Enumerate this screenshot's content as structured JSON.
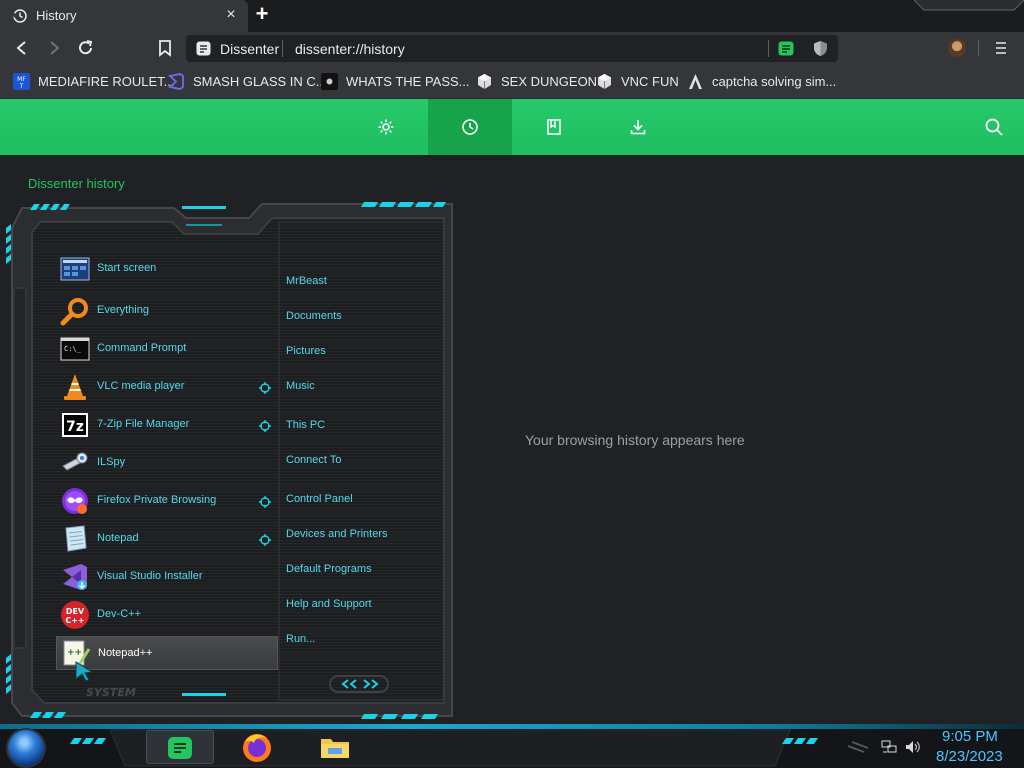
{
  "tab": {
    "title": "History",
    "close_glyph": "×",
    "new_tab_glyph": "+"
  },
  "omnibox": {
    "site": "Dissenter",
    "url": "dissenter://history"
  },
  "bookmarks": [
    {
      "label": "MEDIAFIRE ROULET...",
      "icon": "mediafire-icon"
    },
    {
      "label": "SMASH GLASS IN C...",
      "icon": "visual-studio-icon"
    },
    {
      "label": "WHATS THE PASS...",
      "icon": "gear-favicon-icon"
    },
    {
      "label": "SEX DUNGEON",
      "icon": "cube-favicon-icon"
    },
    {
      "label": "VNC FUN",
      "icon": "cube-favicon-icon"
    },
    {
      "label": "captcha solving sim...",
      "icon": "arch-favicon-icon"
    }
  ],
  "history_page": {
    "title": "Dissenter history",
    "empty_message": "Your browsing history appears here",
    "nav": [
      "settings-icon",
      "history-icon",
      "bookmarks-icon",
      "downloads-icon"
    ]
  },
  "start_menu": {
    "programs": [
      {
        "label": "Start screen",
        "icon": "start-screen-icon"
      },
      {
        "label": "Everything",
        "icon": "magnifier-icon"
      },
      {
        "label": "Command Prompt",
        "icon": "cmd-icon"
      },
      {
        "label": "VLC media player",
        "icon": "vlc-cone-icon"
      },
      {
        "label": "7-Zip File Manager",
        "icon": "7zip-icon"
      },
      {
        "label": "ILSpy",
        "icon": "ilspy-icon"
      },
      {
        "label": "Firefox Private Browsing",
        "icon": "firefox-private-icon"
      },
      {
        "label": "Notepad",
        "icon": "notepad-icon"
      },
      {
        "label": "Visual Studio Installer",
        "icon": "vs-installer-icon"
      },
      {
        "label": "Dev-C++",
        "icon": "devcpp-icon"
      },
      {
        "label": "Notepad++",
        "icon": "notepadpp-icon",
        "selected": true
      }
    ],
    "places": [
      "MrBeast",
      "Documents",
      "Pictures",
      "Music",
      "This PC",
      "Connect To",
      "Control Panel",
      "Devices and Printers",
      "Default Programs",
      "Help and Support",
      "Run..."
    ],
    "footer_text": "SYSTEM"
  },
  "taskbar": {
    "apps": [
      "dissenter-icon",
      "firefox-icon",
      "file-explorer-icon"
    ],
    "time": "9:05 PM",
    "date": "8/23/2023"
  },
  "colors": {
    "accent_green": "#22c55e",
    "cyan": "#55d8ee",
    "clock": "#4cc6ff"
  }
}
